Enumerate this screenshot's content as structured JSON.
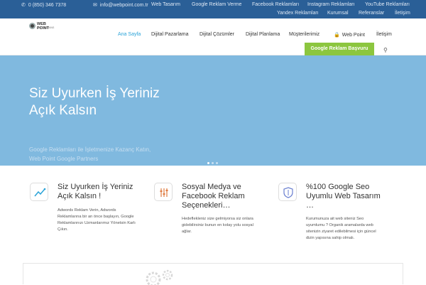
{
  "topbar": {
    "phone": "0 (850) 346 7378",
    "email": "info@webpoint.com.tr",
    "links": [
      "Web Tasarım",
      "Google Reklam Verme",
      "Facebook Reklamları",
      "Instagram Reklamları",
      "YouTube Reklamları"
    ],
    "links2": [
      "Yandex Reklamları",
      "Kurumsal",
      "Referanslar",
      "İletişim"
    ]
  },
  "logo": {
    "title": "WEB POINT",
    "sub": "DİJİTAL AJANS"
  },
  "nav": {
    "items": [
      "Ana Sayfa",
      "Dijital Pazarlama",
      "Dijital Çözümler",
      "Dijital Planlama",
      "Müşterilerimiz",
      "Web Point",
      "İletişim"
    ],
    "cta": "Google Reklam Başvuru"
  },
  "hero": {
    "title_line1": "Siz Uyurken İş Yeriniz",
    "title_line2": "Açık Kalsın",
    "sub_line1": "Google Reklamları ile İşletmenize Kazanç Katın,",
    "sub_line2": "Web Point Google Partners"
  },
  "features": [
    {
      "icon": "chart-line-icon",
      "title1": "Siz Uyurken İş Yeriniz",
      "title2": "Açık Kalsın !",
      "text": [
        "Adwords Reklam Verin, Adwords",
        "Reklamlarına bir an önce başlayın, Google",
        " Reklamlarınızı Uzmanlarımız Yönetsin Karlı",
        "Çıkın."
      ]
    },
    {
      "icon": "sliders-icon",
      "title1": "Sosyal Medya ve",
      "title2": "Facebook Reklam",
      "title3": "Seçenekleri…",
      "text": [
        "Hedeflekleniz size gelmiyorsa siz onlara",
        "gidebilirsiniz bunun en kolay yolu sosyal",
        "ağlar."
      ]
    },
    {
      "icon": "shield-icon",
      "title1": "%100 Google Seo",
      "title2": "Uyumlu Web Tasarım",
      "title3": "…",
      "text": [
        "Kurumunuza ait web siteniz Seo",
        "uyumlumu ? Organik aramalarda web",
        "sitenizin ziyaret edilebilmesi için güncel",
        "dizin yapısına sahip olmalı."
      ]
    }
  ],
  "colors": {
    "topbar": "#2a5f97",
    "hero": "#80b9df",
    "cta": "#8cc63f",
    "active": "#2aa3d8"
  }
}
